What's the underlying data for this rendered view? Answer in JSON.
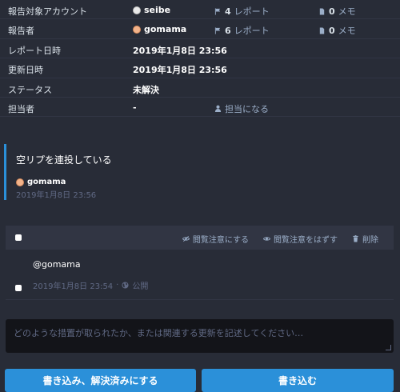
{
  "info": {
    "rows": [
      {
        "key": "報告対象アカウント",
        "value": "seibe",
        "reports_count": "4",
        "reports_label": "レポート",
        "memo_count": "0",
        "memo_label": "メモ"
      },
      {
        "key": "報告者",
        "value": "gomama",
        "reports_count": "6",
        "reports_label": "レポート",
        "memo_count": "0",
        "memo_label": "メモ"
      },
      {
        "key": "レポート日時",
        "value": "2019年1月8日 23:56"
      },
      {
        "key": "更新日時",
        "value": "2019年1月8日 23:56"
      },
      {
        "key": "ステータス",
        "value": "未解決"
      },
      {
        "key": "担当者",
        "value": "-",
        "assign_label": "担当になる"
      }
    ]
  },
  "report": {
    "comment": "空リプを連投している",
    "author": "gomama",
    "date": "2019年1月8日 23:56"
  },
  "statuses": {
    "actions": {
      "mark_sensitive": "閲覧注意にする",
      "unmark_sensitive": "閲覧注意をはずす",
      "delete": "削除"
    },
    "items": [
      {
        "content": "@gomama",
        "date": "2019年1月8日 23:54",
        "visibility": "公開"
      }
    ]
  },
  "note": {
    "placeholder": "どのような措置が取られたか、または関連する更新を記述してください…"
  },
  "buttons": {
    "resolve": "書き込み、解決済みにする",
    "submit": "書き込む"
  },
  "colors": {
    "background": "#282c37",
    "accent": "#2b90d9",
    "input_bg": "#131419"
  }
}
